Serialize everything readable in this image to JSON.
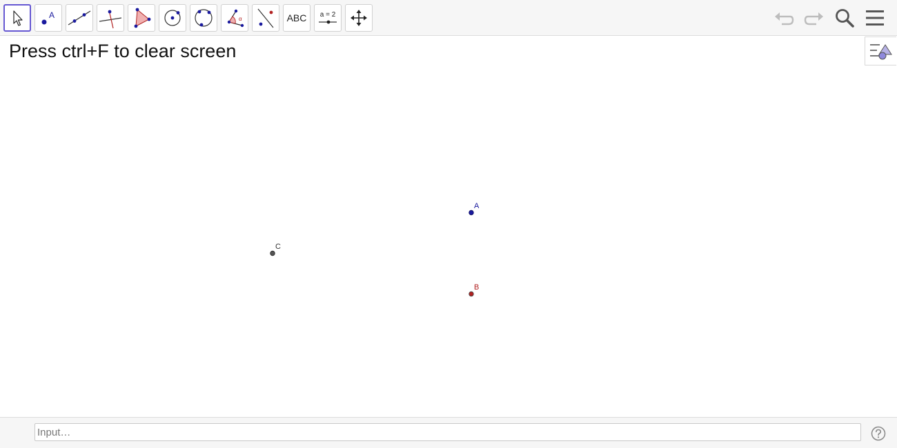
{
  "toolbar": {
    "tools": [
      {
        "name": "move-tool-icon",
        "selected": true
      },
      {
        "name": "point-tool-icon",
        "label": "A"
      },
      {
        "name": "line-tool-icon"
      },
      {
        "name": "perpendicular-line-tool-icon"
      },
      {
        "name": "polygon-tool-icon"
      },
      {
        "name": "circle-center-point-tool-icon"
      },
      {
        "name": "circle-three-points-tool-icon"
      },
      {
        "name": "angle-tool-icon",
        "label": "α"
      },
      {
        "name": "reflect-about-line-tool-icon"
      },
      {
        "name": "text-tool-icon",
        "label": "ABC"
      },
      {
        "name": "slider-tool-icon",
        "label": "a = 2"
      },
      {
        "name": "move-graphics-view-tool-icon"
      }
    ],
    "controls": [
      "undo-icon",
      "redo-icon",
      "search-icon",
      "menu-icon"
    ]
  },
  "graphics": {
    "instruction": "Press ctrl+F to clear screen",
    "points": [
      {
        "label": "A",
        "color": "#1a1a9e"
      },
      {
        "label": "B",
        "color": "#b22222"
      },
      {
        "label": "C",
        "color": "#333333"
      }
    ]
  },
  "inputbar": {
    "placeholder": "Input…"
  },
  "colors": {
    "accent": "#6557d2",
    "point_a": "#1a1a9e",
    "point_b": "#b22222",
    "point_c": "#333333"
  }
}
